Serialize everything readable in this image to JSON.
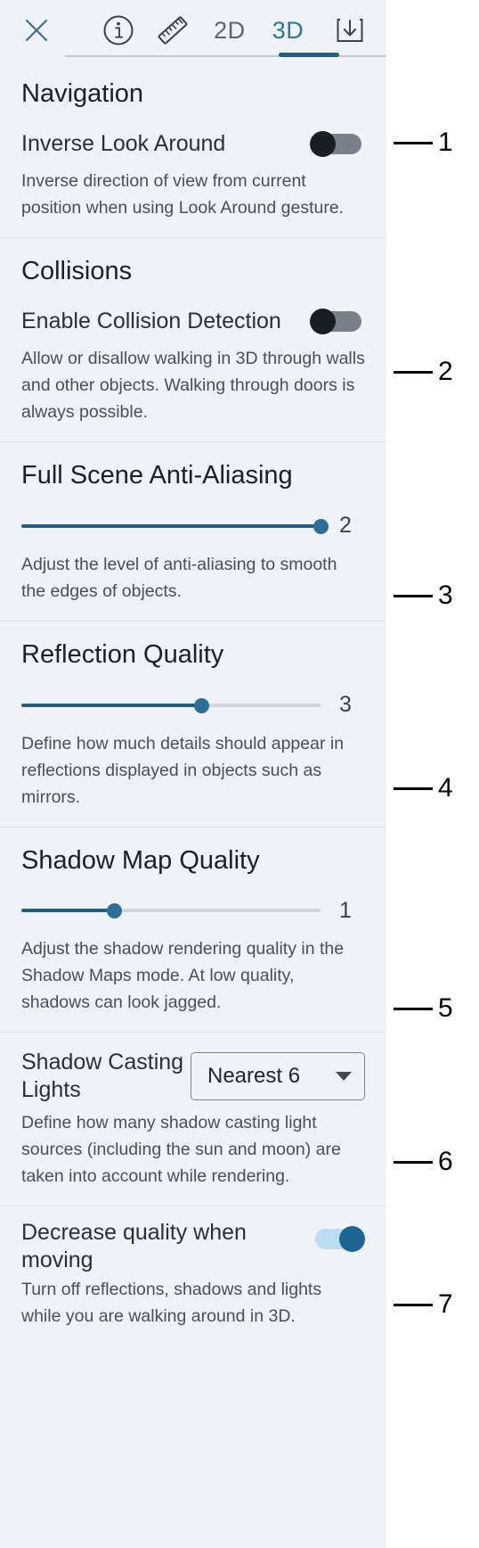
{
  "toolbar": {
    "close_icon": "close-icon",
    "info_icon": "info-circle-icon",
    "measure_icon": "ruler-icon",
    "tab_2d": "2D",
    "tab_3d": "3D",
    "active_tab": "3D",
    "download_icon": "download-icon",
    "accent_color": "#2f74a0"
  },
  "sections": [
    {
      "title": "Navigation",
      "label": "Inverse Look Around",
      "control": "toggle",
      "state": "off",
      "description": "Inverse direction of view from current position when using Look Around gesture."
    },
    {
      "title": "Collisions",
      "label": "Enable Collision Detection",
      "control": "toggle",
      "state": "off",
      "description": "Allow or disallow walking in 3D through walls and other objects. Walking through doors is always possible."
    },
    {
      "title": "Full Scene Anti-Aliasing",
      "control": "slider",
      "value": "2",
      "fill_percent": 100,
      "description": "Adjust the level of anti-aliasing to smooth the edges of objects."
    },
    {
      "title": "Reflection Quality",
      "control": "slider",
      "value": "3",
      "fill_percent": 60,
      "description": "Define how much details should appear in reflections displayed in objects such as mirrors."
    },
    {
      "title": "Shadow Map Quality",
      "control": "slider",
      "value": "1",
      "fill_percent": 31,
      "description": "Adjust the shadow rendering quality in the Shadow Maps mode. At low quality, shadows can look jagged."
    },
    {
      "title": "",
      "label": "Shadow Casting Lights",
      "control": "dropdown",
      "value": "Nearest 6",
      "description": "Define how many shadow casting light sources (including the sun and moon) are taken into account while rendering."
    },
    {
      "title": "",
      "label": "Decrease quality when moving",
      "control": "toggle",
      "state": "on",
      "description": "Turn off reflections, shadows and lights while you are walking around in 3D."
    }
  ],
  "callouts": [
    {
      "number": "1"
    },
    {
      "number": "2"
    },
    {
      "number": "3"
    },
    {
      "number": "4"
    },
    {
      "number": "5"
    },
    {
      "number": "6"
    },
    {
      "number": "7"
    }
  ]
}
